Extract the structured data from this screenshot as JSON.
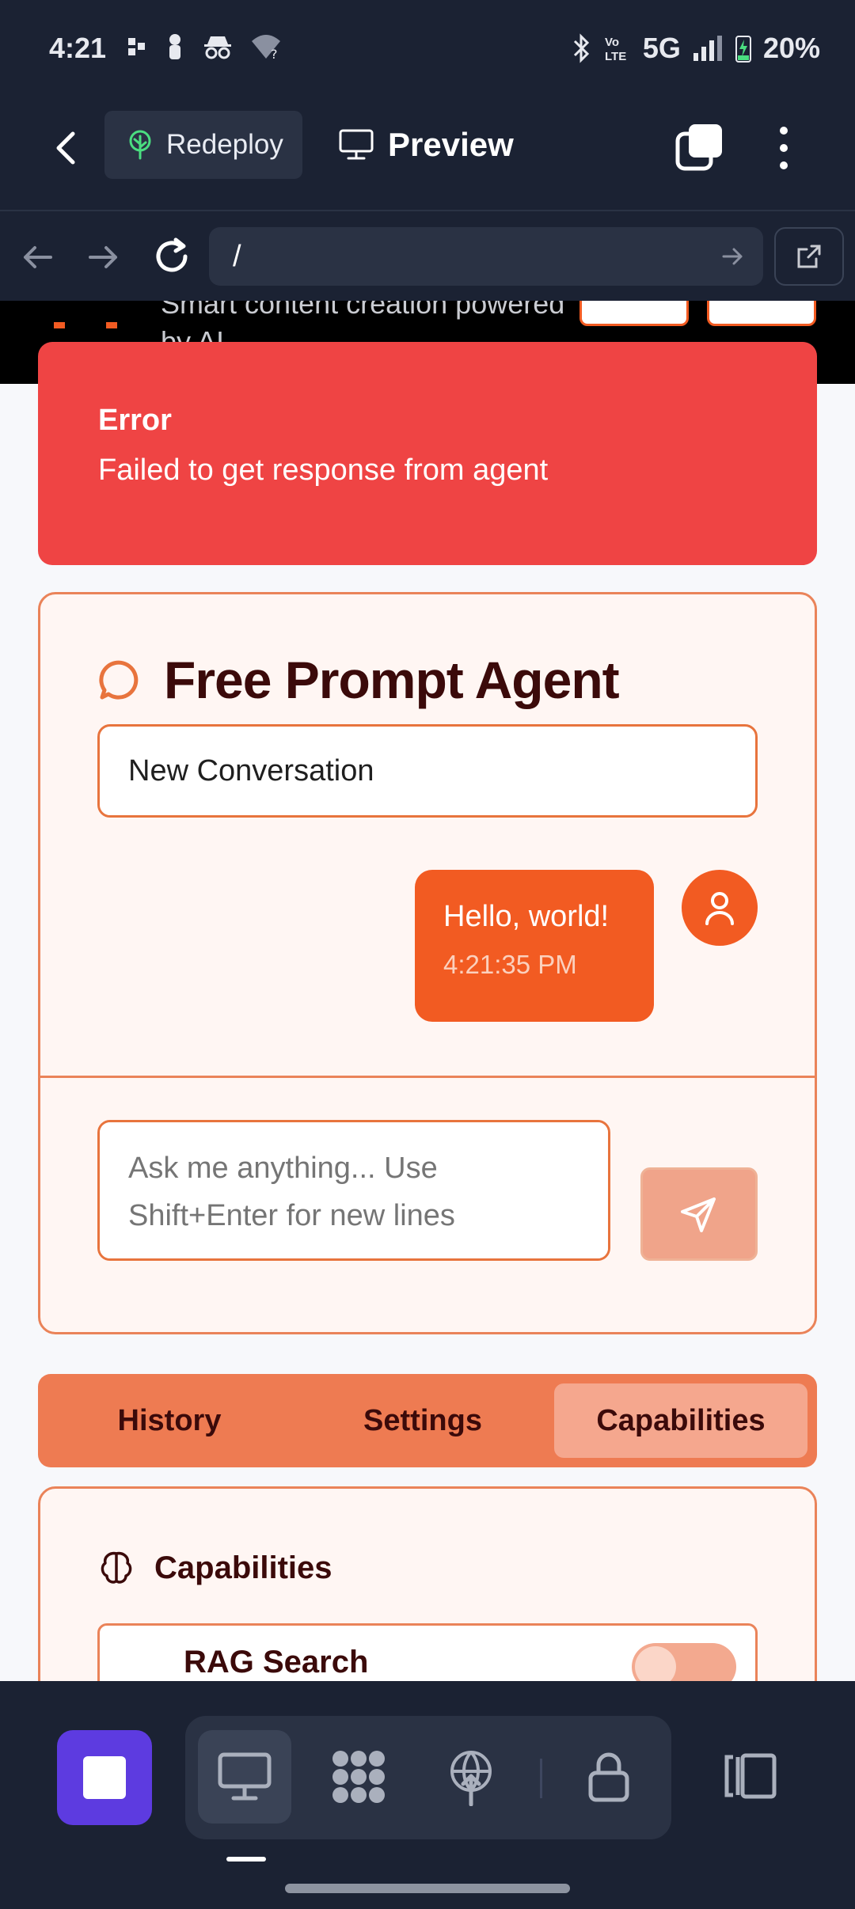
{
  "status_bar": {
    "time": "4:21",
    "network": "5G",
    "battery": "20%"
  },
  "app_bar": {
    "redeploy_label": "Redeploy",
    "preview_label": "Preview"
  },
  "browser": {
    "url": "/"
  },
  "site_header": {
    "tagline": "Smart content creation powered by AI"
  },
  "error": {
    "title": "Error",
    "message": "Failed to get response from agent"
  },
  "agent": {
    "title": "Free Prompt Agent",
    "conversation": "New Conversation",
    "messages": [
      {
        "text": "Hello, world!",
        "time": "4:21:35 PM"
      }
    ],
    "input_placeholder": "Ask me anything... Use Shift+Enter for new lines"
  },
  "tabs": [
    {
      "label": "History",
      "active": false
    },
    {
      "label": "Settings",
      "active": false
    },
    {
      "label": "Capabilities",
      "active": true
    }
  ],
  "capabilities": {
    "title": "Capabilities",
    "items": [
      {
        "label": "RAG Search",
        "enabled": false
      }
    ]
  },
  "colors": {
    "accent": "#f25b22",
    "error": "#ef4444",
    "dark": "#1b2233",
    "dock_app": "#5d3be0"
  }
}
